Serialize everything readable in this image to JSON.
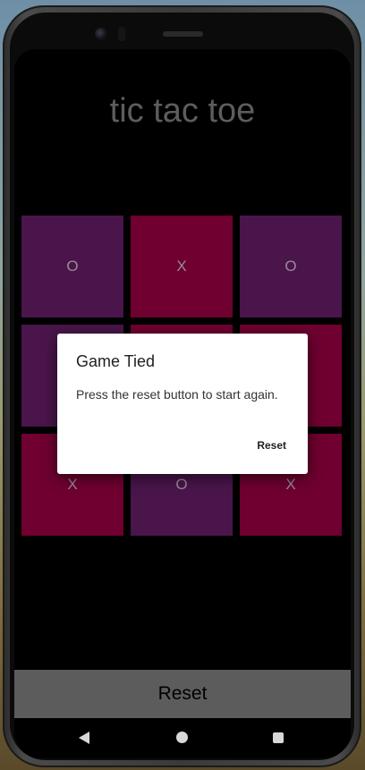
{
  "app": {
    "title": "tic tac toe",
    "reset_label": "Reset"
  },
  "board": [
    {
      "mark": "O",
      "color": "#4a154b"
    },
    {
      "mark": "X",
      "color": "#6f0030"
    },
    {
      "mark": "O",
      "color": "#4a154b"
    },
    {
      "mark": "",
      "color": "#4a154b"
    },
    {
      "mark": "",
      "color": "#6f0030"
    },
    {
      "mark": "",
      "color": "#6f0030"
    },
    {
      "mark": "X",
      "color": "#6f0030"
    },
    {
      "mark": "O",
      "color": "#4a154b"
    },
    {
      "mark": "X",
      "color": "#6f0030"
    }
  ],
  "dialog": {
    "title": "Game Tied",
    "message": "Press the reset button to start again.",
    "button_label": "Reset"
  },
  "navbar": {
    "back_icon": "back-icon",
    "home_icon": "home-icon",
    "recents_icon": "recents-icon"
  }
}
